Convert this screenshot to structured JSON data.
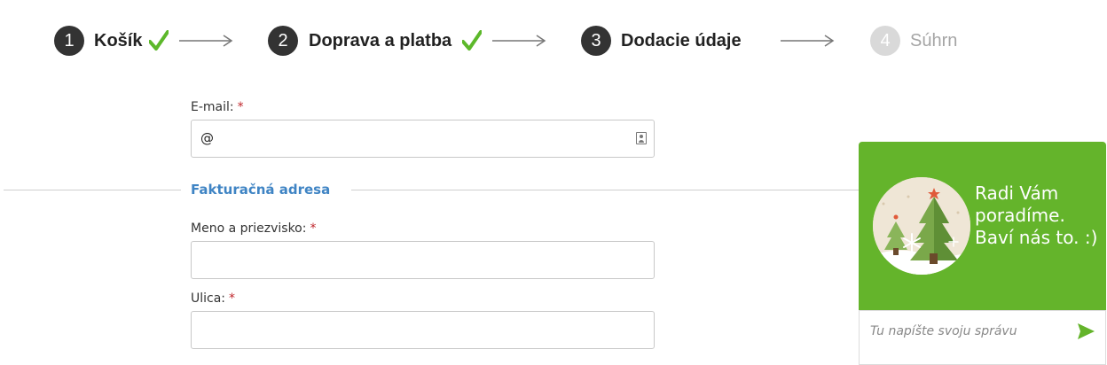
{
  "steps": [
    {
      "number": "1",
      "label": "Košík",
      "state": "done"
    },
    {
      "number": "2",
      "label": "Doprava a platba",
      "state": "done"
    },
    {
      "number": "3",
      "label": "Dodacie údaje",
      "state": "active"
    },
    {
      "number": "4",
      "label": "Súhrn",
      "state": "inactive"
    }
  ],
  "form": {
    "email": {
      "label": "E-mail:",
      "required_mark": "*",
      "value": "@"
    },
    "section_title": "Fakturačná adresa",
    "name": {
      "label": "Meno a priezvisko:",
      "required_mark": "*",
      "value": ""
    },
    "street": {
      "label": "Ulica:",
      "required_mark": "*",
      "value": ""
    }
  },
  "chat": {
    "message": "Radi Vám poradíme. Baví nás to. :)",
    "input_placeholder": "Tu napíšte svoju správu"
  },
  "colors": {
    "step_active": "#333333",
    "step_inactive": "#d9d9d9",
    "check_green": "#5cb82a",
    "section_blue": "#3f84c4",
    "required_red": "#c0272d",
    "chat_green": "#64b42b"
  },
  "icons": {
    "step_done": "checkmark-icon",
    "step_separator": "arrow-right-icon",
    "email_field": "contact-card-icon",
    "chat_send": "send-icon"
  }
}
